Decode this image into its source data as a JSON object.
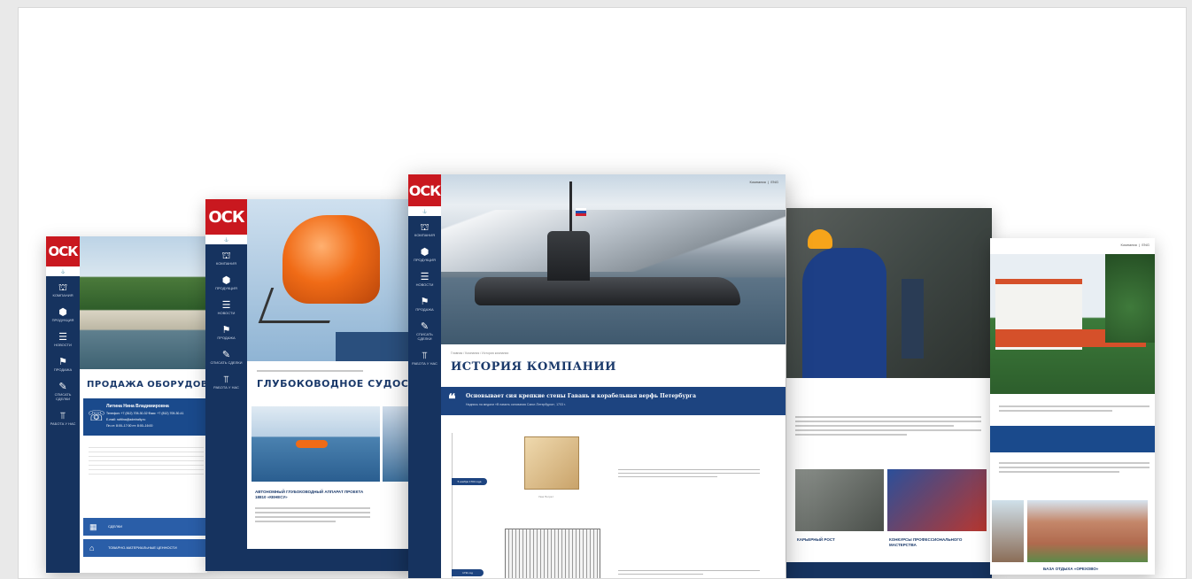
{
  "brand": {
    "logo": "ОСК"
  },
  "nav": {
    "items": [
      {
        "label": "Компания",
        "icon": "building-icon"
      },
      {
        "label": "Продукция",
        "icon": "cube-icon"
      },
      {
        "label": "Новости",
        "icon": "list-icon"
      },
      {
        "label": "Продажа",
        "icon": "tag-icon"
      },
      {
        "label": "Списать сделки",
        "icon": "edit-icon"
      },
      {
        "label": "Работа у нас",
        "icon": "crane-icon"
      }
    ]
  },
  "card1": {
    "title": "ПРОДАЖА ОБОРУДОВАНИЯ",
    "contact_name": "Литина Нина Владимировна",
    "contact_phone": "Телефон: +7 (812) 705-30-32 Факс: +7 (812) 705-30-41",
    "contact_email": "E-mail: nvlitina@admiralty.ru",
    "contact_hours": "Пн-чт: 8:00–17:00  пт: 8:00–16:00",
    "btn1": "Сделки",
    "btn2": "Товарно-материальные ценности"
  },
  "card2": {
    "title": "ГЛУБОКОВОДНОЕ СУДОСТРОЕНИЕ",
    "caption": "АВТОНОМНЫЙ ГЛУБОКОВОДНЫЙ АППАРАТ ПРОЕКТА 18810 «КЕНЕСУ»"
  },
  "card3": {
    "topnav": "Компания  |  ENG",
    "breadcrumb": "Главная / Компания / История компании",
    "title": "ИСТОРИЯ КОМПАНИИ",
    "quote": "Основывает сия крепкие стены Гавань и корабельная верфь Петербурга",
    "quote_sub": "Надпись на медали «В память основания Санкт-Петербурга», 1703 г.",
    "date1": "5 ноября 1704 года",
    "date2": "1711 год",
    "doc_caption": "Указ Петра I"
  },
  "card4": {
    "caption1": "КАРЬЕРНЫЙ РОСТ",
    "caption2": "КОНКУРСЫ ПРОФЕССИОНАЛЬНОГО МАСТЕРСТВА"
  },
  "card5": {
    "topnav": "Компания  |  ENG",
    "caption": "БАЗА ОТДЫХА «ОРЕХОВО»"
  }
}
